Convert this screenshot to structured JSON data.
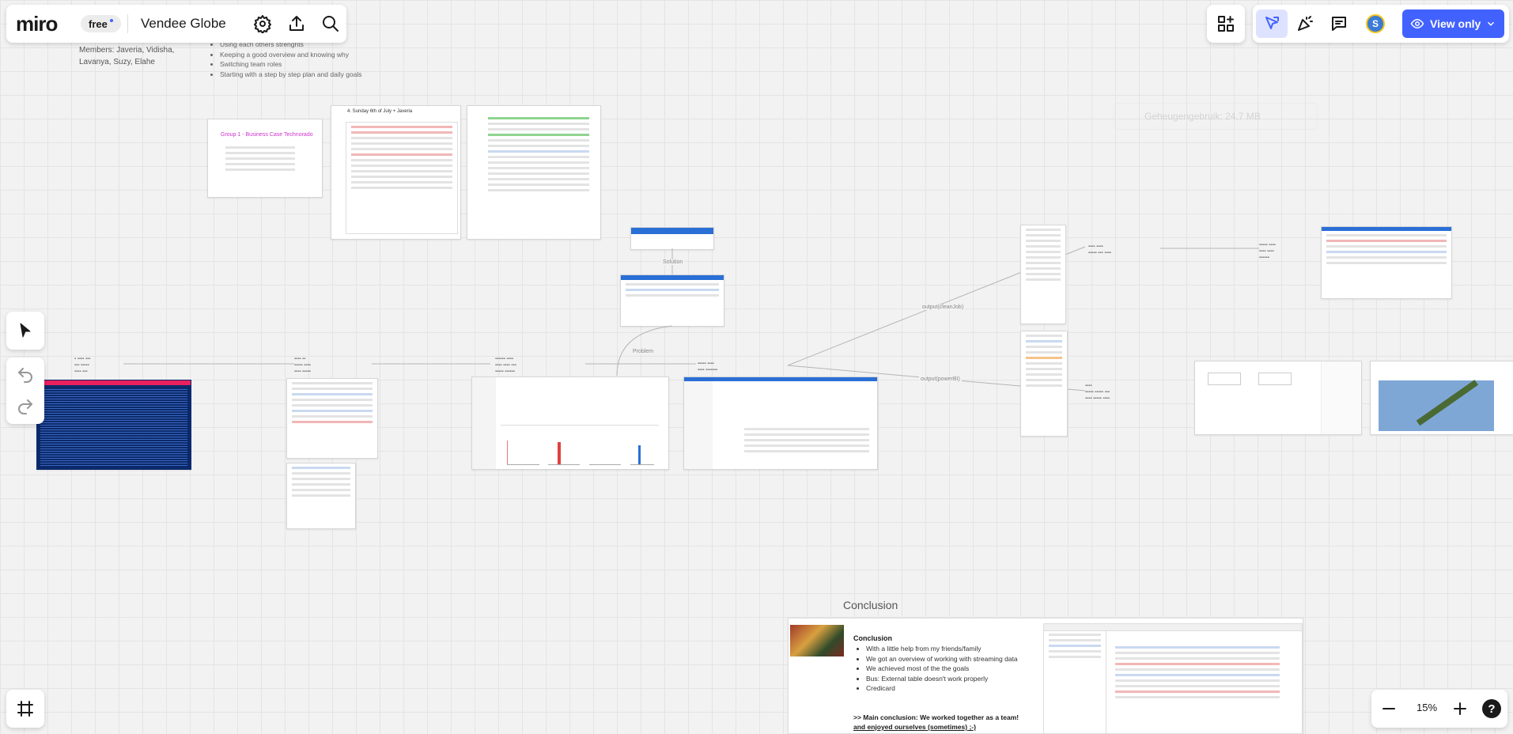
{
  "app": {
    "logo": "miro",
    "plan_badge": "free",
    "board_title": "Vendee Globe"
  },
  "right_toolbar": {
    "avatar_initial": "S",
    "view_only_label": "View only"
  },
  "notes": {
    "members": "Members: Javeria, Vidisha, Lavanya, Suzy, Elahe",
    "bullets": [
      "Using each others strenghts",
      "Keeping a good overview and knowing why",
      "Switching team roles",
      "Starting with a step by step plan and daily goals"
    ]
  },
  "faded_widget": {
    "text": "Geheugengebruik: 24,7 MB"
  },
  "cards": {
    "business_case_title": "Group 1 - Business Case Technorado",
    "sunday_title": "4. Sunday 6th of July + Javeria"
  },
  "connector_labels": {
    "solution": "Solution",
    "problem": "Problem",
    "output": "output(cleanJob)",
    "output2": "output(powerBI)"
  },
  "conclusion": {
    "heading": "Conclusion",
    "card_title": "Conclusion",
    "bullets": [
      "With a little help from my friends/family",
      "We got an overview of working with streaming data",
      "We achieved most of the the goals",
      "Bus: External table doesn't work properly",
      "Credicard"
    ],
    "main_line1": ">> Main conclusion: We worked together as a team!",
    "main_line2": "and enjoyed ourselves (sometimes) ;-)"
  },
  "zoom": {
    "level": "15%"
  },
  "colors": {
    "accent": "#4262ff",
    "accent_bg": "#dde3ff",
    "avatar": "#f5c518",
    "terminal": "#0b2a6b",
    "pink_header": "#e8205e",
    "title_purple": "#cc33cc"
  }
}
